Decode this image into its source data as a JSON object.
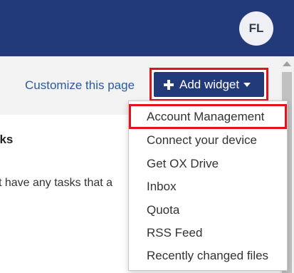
{
  "header": {
    "icons": [
      "refresh-icon",
      "help-icon",
      "settings-gear-icon"
    ],
    "avatar_initials": "FL",
    "colors": {
      "bar": "#233a7a",
      "avatar_bg": "#eef0f6"
    }
  },
  "toolbar": {
    "customize_label": "Customize this page",
    "add_widget_label": "Add widget"
  },
  "widget": {
    "title": "sks",
    "text_line1": "n't have any tasks that a",
    "text_line2": "e."
  },
  "dropdown": {
    "items": [
      "Account Management",
      "Connect your device",
      "Get OX Drive",
      "Inbox",
      "Quota",
      "RSS Feed",
      "Recently changed files"
    ],
    "highlighted_index": 0,
    "highlight_color": "#e0141e"
  }
}
